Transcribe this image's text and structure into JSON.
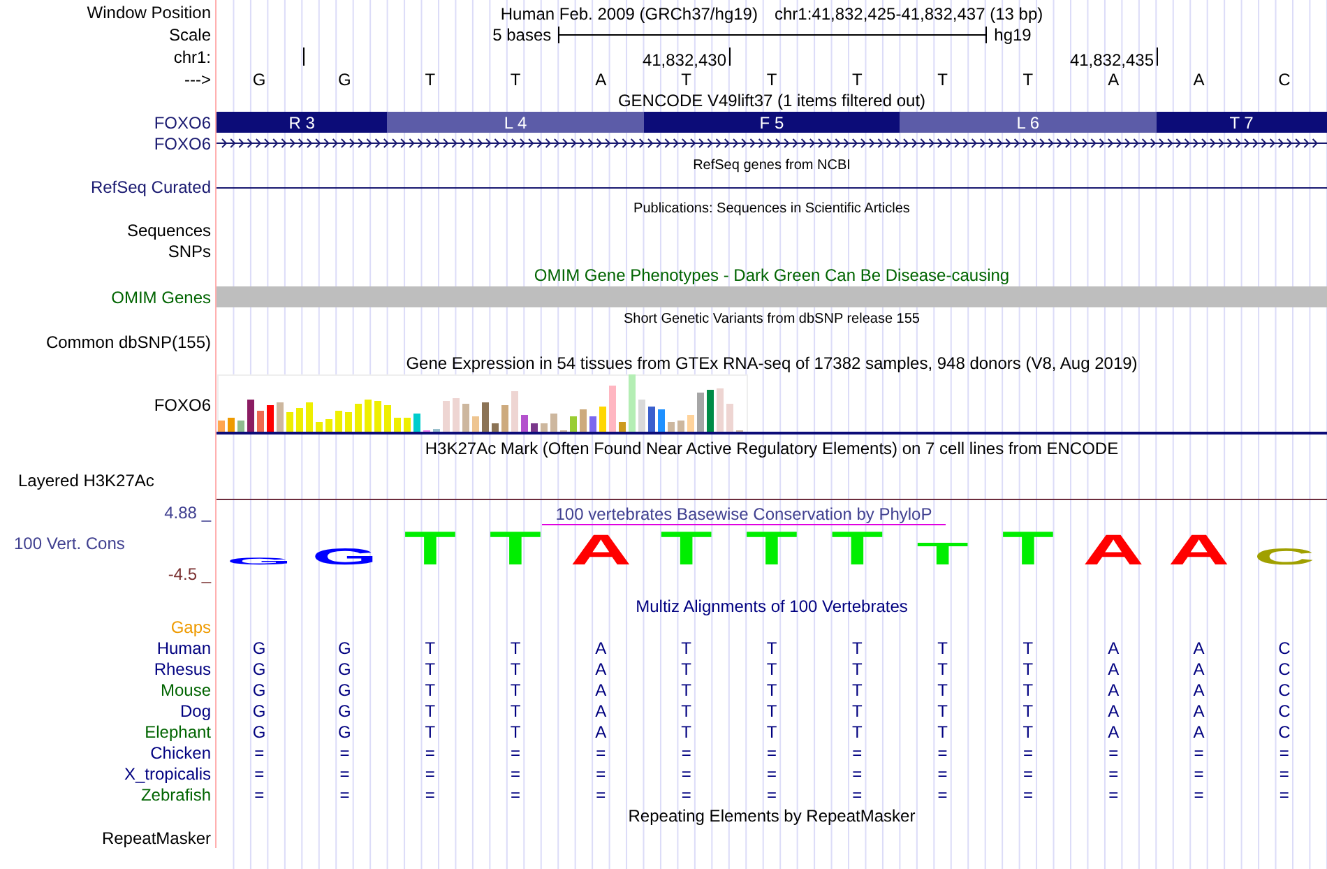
{
  "position": {
    "label": "Window Position",
    "assembly": "Human Feb. 2009 (GRCh37/hg19)",
    "range": "chr1:41,832,425-41,832,437 (13 bp)"
  },
  "scale": {
    "label": "Scale",
    "size": "5 bases",
    "db": "hg19"
  },
  "coordinates": {
    "label": "chr1:",
    "ticks": [
      "41,832,430",
      "41,832,435"
    ]
  },
  "sequence": {
    "label": "--->",
    "bases": [
      "G",
      "G",
      "T",
      "T",
      "A",
      "T",
      "T",
      "T",
      "T",
      "T",
      "A",
      "A",
      "C"
    ]
  },
  "gencode": {
    "title": "GENCODE V49lift37 (1 items filtered out)",
    "label": "FOXO6",
    "strand_label": "FOXO6",
    "exons": [
      {
        "label": "R 3",
        "color": "#0c0c78"
      },
      {
        "label": "L 4",
        "color": "#5c5ca8"
      },
      {
        "label": "F 5",
        "color": "#0c0c78"
      },
      {
        "label": "L 6",
        "color": "#5c5ca8"
      },
      {
        "label": "T 7",
        "color": "#0c0c78"
      }
    ]
  },
  "refseq": {
    "title": "RefSeq genes from NCBI",
    "label": "RefSeq Curated"
  },
  "publications": {
    "title": "Publications: Sequences in Scientific Articles",
    "labels": [
      "Sequences",
      "SNPs"
    ]
  },
  "omim": {
    "title": "OMIM Gene Phenotypes - Dark Green Can Be Disease-causing",
    "label": "OMIM Genes"
  },
  "dbsnp": {
    "title": "Short Genetic Variants from dbSNP release 155",
    "label": "Common dbSNP(155)"
  },
  "gtex": {
    "title": "Gene Expression in 54 tissues from GTEx RNA-seq of 17382 samples, 948 donors (V8, Aug 2019)",
    "label": "FOXO6"
  },
  "h3k27ac": {
    "title": "H3K27Ac Mark (Often Found Near Active Regulatory Elements) on 7 cell lines from ENCODE",
    "label": "Layered H3K27Ac"
  },
  "conservation": {
    "title": "100 vertebrates Basewise Conservation by PhyloP",
    "label": "100 Vert. Cons",
    "y_max": "4.88 _",
    "y_min": "-4.5 _",
    "bases": [
      {
        "base": "G",
        "color": "#0000ff"
      },
      {
        "base": "G",
        "color": "#0000ff"
      },
      {
        "base": "T",
        "color": "#00ee00"
      },
      {
        "base": "T",
        "color": "#00ee00"
      },
      {
        "base": "A",
        "color": "#ff0000"
      },
      {
        "base": "T",
        "color": "#00ee00"
      },
      {
        "base": "T",
        "color": "#00ee00"
      },
      {
        "base": "T",
        "color": "#00ee00"
      },
      {
        "base": "T",
        "color": "#00ee00"
      },
      {
        "base": "T",
        "color": "#00ee00"
      },
      {
        "base": "A",
        "color": "#ff0000"
      },
      {
        "base": "A",
        "color": "#ff0000"
      },
      {
        "base": "C",
        "color": "#a0a000"
      }
    ]
  },
  "multiz": {
    "title": "Multiz Alignments of 100 Vertebrates",
    "gaps_label": "Gaps",
    "species": [
      {
        "name": "Human",
        "color": "#000080",
        "bases": [
          "G",
          "G",
          "T",
          "T",
          "A",
          "T",
          "T",
          "T",
          "T",
          "T",
          "A",
          "A",
          "C"
        ]
      },
      {
        "name": "Rhesus",
        "color": "#000080",
        "bases": [
          "G",
          "G",
          "T",
          "T",
          "A",
          "T",
          "T",
          "T",
          "T",
          "T",
          "A",
          "A",
          "C"
        ]
      },
      {
        "name": "Mouse",
        "color": "#006400",
        "bases": [
          "G",
          "G",
          "T",
          "T",
          "A",
          "T",
          "T",
          "T",
          "T",
          "T",
          "A",
          "A",
          "C"
        ]
      },
      {
        "name": "Dog",
        "color": "#000080",
        "bases": [
          "G",
          "G",
          "T",
          "T",
          "A",
          "T",
          "T",
          "T",
          "T",
          "T",
          "A",
          "A",
          "C"
        ]
      },
      {
        "name": "Elephant",
        "color": "#006400",
        "bases": [
          "G",
          "G",
          "T",
          "T",
          "A",
          "T",
          "T",
          "T",
          "T",
          "T",
          "A",
          "A",
          "C"
        ]
      },
      {
        "name": "Chicken",
        "color": "#000080",
        "bases": [
          "=",
          "=",
          "=",
          "=",
          "=",
          "=",
          "=",
          "=",
          "=",
          "=",
          "=",
          "=",
          "="
        ]
      },
      {
        "name": "X_tropicalis",
        "color": "#000080",
        "bases": [
          "=",
          "=",
          "=",
          "=",
          "=",
          "=",
          "=",
          "=",
          "=",
          "=",
          "=",
          "=",
          "="
        ]
      },
      {
        "name": "Zebrafish",
        "color": "#006400",
        "bases": [
          "=",
          "=",
          "=",
          "=",
          "=",
          "=",
          "=",
          "=",
          "=",
          "=",
          "=",
          "=",
          "="
        ]
      }
    ]
  },
  "repeatmasker": {
    "title": "Repeating Elements by RepeatMasker",
    "label": "RepeatMasker"
  }
}
